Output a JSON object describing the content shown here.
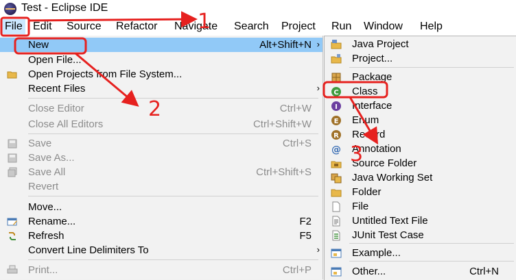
{
  "window": {
    "title": "Test - Eclipse IDE"
  },
  "menubar": {
    "items": [
      "File",
      "Edit",
      "Source",
      "Refactor",
      "Navigate",
      "Search",
      "Project",
      "Run",
      "Window",
      "Help"
    ]
  },
  "file_menu": {
    "items": [
      {
        "label": "New",
        "accel": "Alt+Shift+N",
        "submenu": true,
        "highlight": true
      },
      {
        "label": "Open File..."
      },
      {
        "label": "Open Projects from File System..."
      },
      {
        "label": "Recent Files",
        "submenu": true
      },
      {
        "label": "Close Editor",
        "accel": "Ctrl+W",
        "disabled": true
      },
      {
        "label": "Close All Editors",
        "accel": "Ctrl+Shift+W",
        "disabled": true
      },
      {
        "label": "Save",
        "accel": "Ctrl+S",
        "disabled": true
      },
      {
        "label": "Save As...",
        "disabled": true
      },
      {
        "label": "Save All",
        "accel": "Ctrl+Shift+S",
        "disabled": true
      },
      {
        "label": "Revert",
        "disabled": true
      },
      {
        "label": "Move..."
      },
      {
        "label": "Rename...",
        "accel": "F2"
      },
      {
        "label": "Refresh",
        "accel": "F5"
      },
      {
        "label": "Convert Line Delimiters To",
        "submenu": true
      },
      {
        "label": "Print...",
        "accel": "Ctrl+P",
        "disabled": true
      }
    ]
  },
  "new_submenu": {
    "items": [
      {
        "label": "Java Project",
        "icon": "java-project-icon"
      },
      {
        "label": "Project...",
        "icon": "project-icon"
      },
      {
        "label": "Package",
        "icon": "package-icon"
      },
      {
        "label": "Class",
        "icon": "class-icon"
      },
      {
        "label": "Interface",
        "icon": "interface-icon"
      },
      {
        "label": "Enum",
        "icon": "enum-icon"
      },
      {
        "label": "Record",
        "icon": "record-icon"
      },
      {
        "label": "Annotation",
        "icon": "annotation-icon"
      },
      {
        "label": "Source Folder",
        "icon": "source-folder-icon"
      },
      {
        "label": "Java Working Set",
        "icon": "working-set-icon"
      },
      {
        "label": "Folder",
        "icon": "folder-icon"
      },
      {
        "label": "File",
        "icon": "file-icon"
      },
      {
        "label": "Untitled Text File",
        "icon": "text-file-icon"
      },
      {
        "label": "JUnit Test Case",
        "icon": "junit-icon"
      },
      {
        "label": "Example...",
        "icon": "example-icon"
      },
      {
        "label": "Other...",
        "accel": "Ctrl+N",
        "icon": "other-icon"
      }
    ]
  },
  "annotations": {
    "step1": "1",
    "step2": "2",
    "step3": "3",
    "color": "#e6211f"
  }
}
